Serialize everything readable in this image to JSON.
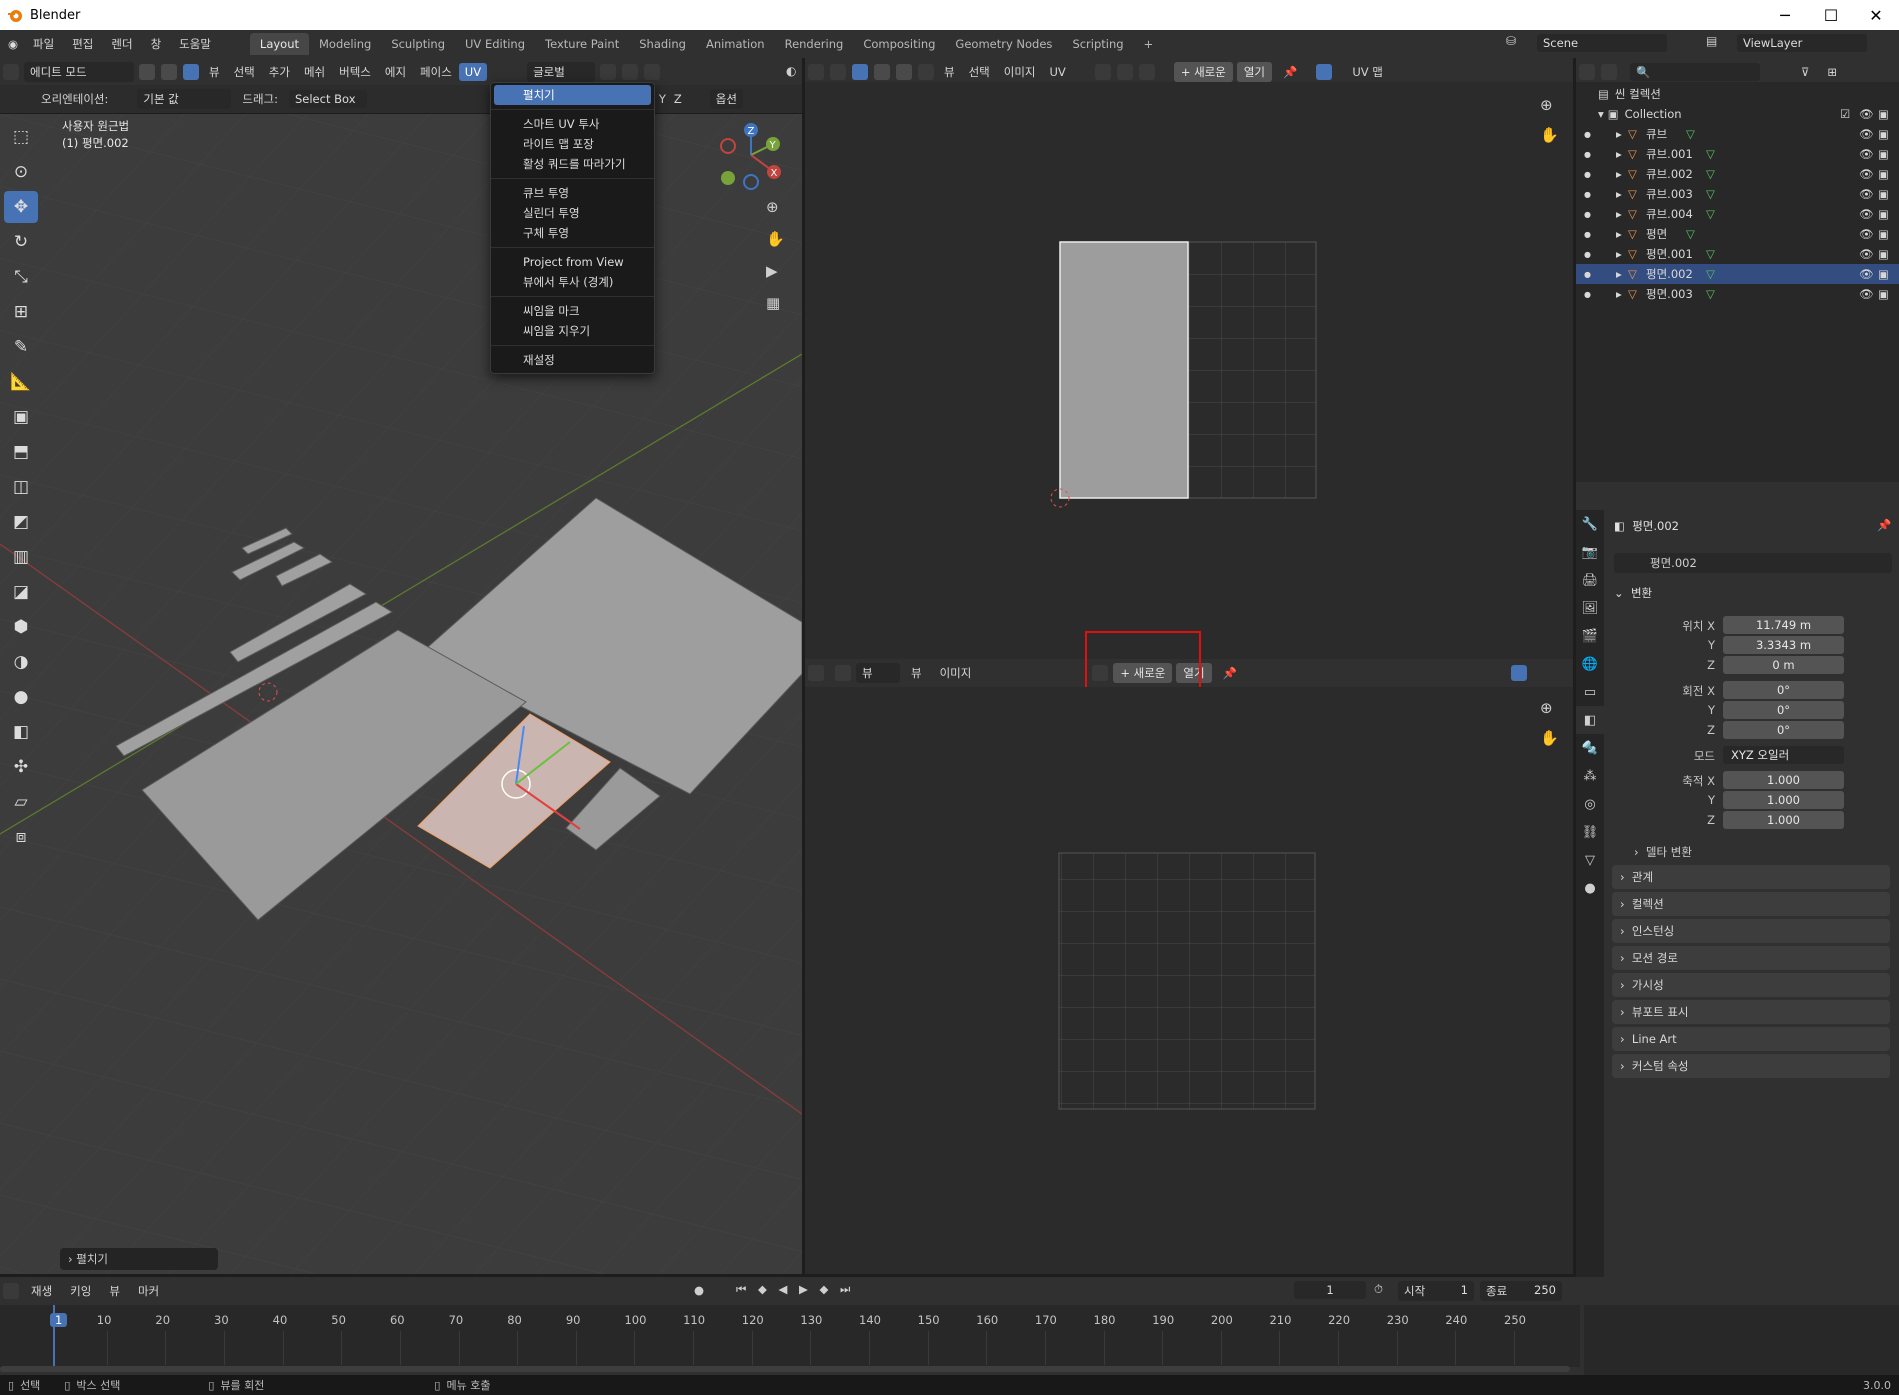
{
  "window": {
    "title": "Blender",
    "controls": [
      "─",
      "☐",
      "✕"
    ]
  },
  "menubar": {
    "items": [
      "파일",
      "편집",
      "렌더",
      "창",
      "도움말"
    ],
    "workspaces": [
      "Layout",
      "Modeling",
      "Sculpting",
      "UV Editing",
      "Texture Paint",
      "Shading",
      "Animation",
      "Rendering",
      "Compositing",
      "Geometry Nodes",
      "Scripting",
      "+"
    ],
    "active_workspace": "Layout",
    "scene": "Scene",
    "view_layer": "ViewLayer"
  },
  "viewport": {
    "mode": "에디트 모드",
    "menus": [
      "뷰",
      "선택",
      "추가",
      "메쉬",
      "버텍스",
      "에지",
      "페이스",
      "UV"
    ],
    "transform_orientation": "글로벌",
    "orientation_label": "오리엔테이션:",
    "orientation_value": "기본 값",
    "drag_label": "드래그:",
    "drag_value": "Select Box",
    "axes": [
      "X",
      "Y",
      "Z"
    ],
    "options": "옵션",
    "overlay_title": "사용자 원근법",
    "overlay_object": "(1) 평면.002",
    "last_op": "펼치기"
  },
  "uv_menu": {
    "items": [
      "펼치기",
      "스마트 UV 투사",
      "라이트 맵 포장",
      "활성 쿼드를 따라가기",
      "큐브 투영",
      "실린더 투영",
      "구체 투영",
      "Project from View",
      "뷰에서 투사 (경계)",
      "씨임을 마크",
      "씨임을 지우기",
      "재설정"
    ],
    "highlighted": "펼치기"
  },
  "uv_editor_top": {
    "menus": [
      "뷰",
      "선택",
      "이미지",
      "UV"
    ],
    "new": "+ 새로운",
    "open": "열기",
    "right_label": "UV 맵"
  },
  "uv_editor_bottom": {
    "menus": [
      "뷰",
      "이미지"
    ],
    "view_dd": "뷰",
    "new": "+ 새로운",
    "open": "열기"
  },
  "outliner": {
    "scene_collection": "씬 컬렉션",
    "collection": "Collection",
    "objects": [
      "큐브",
      "큐브.001",
      "큐브.002",
      "큐브.003",
      "큐브.004",
      "평면",
      "평면.001",
      "평면.002",
      "평면.003"
    ],
    "selected": "평면.002"
  },
  "properties": {
    "object_name": "평면.002",
    "data_name": "평면.002",
    "transform_header": "변환",
    "location_label": "위치 X",
    "location": [
      "11.749 m",
      "3.3343 m",
      "0 m"
    ],
    "rotation_label": "회전 X",
    "rotation": [
      "0°",
      "0°",
      "0°"
    ],
    "mode_label": "모드",
    "mode": "XYZ 오일러",
    "scale_label": "축적 X",
    "scale": [
      "1.000",
      "1.000",
      "1.000"
    ],
    "axis_y": "Y",
    "axis_z": "Z",
    "delta": "델타 변환",
    "panels": [
      "관계",
      "컬렉션",
      "인스턴싱",
      "모션 경로",
      "가시성",
      "뷰포트 표시",
      "Line Art",
      "커스텀 속성"
    ]
  },
  "timeline": {
    "menus": [
      "재생",
      "키잉",
      "뷰",
      "마커"
    ],
    "current_frame": "1",
    "start_label": "시작",
    "start": "1",
    "end_label": "종료",
    "end": "250",
    "ticks": [
      "1",
      "10",
      "20",
      "30",
      "40",
      "50",
      "60",
      "70",
      "80",
      "90",
      "100",
      "110",
      "120",
      "130",
      "140",
      "150",
      "160",
      "170",
      "180",
      "190",
      "200",
      "210",
      "220",
      "230",
      "240",
      "250"
    ]
  },
  "statusbar": {
    "items": [
      "선택",
      "박스 선택",
      "뷰를 회전",
      "메뉴 호출"
    ],
    "version": "3.0.0"
  },
  "colors": {
    "accent": "#4772b3",
    "highlight_box": "#e01010",
    "axis_x": "#c2443f",
    "axis_y": "#77a33a",
    "axis_z": "#3f74c2"
  }
}
